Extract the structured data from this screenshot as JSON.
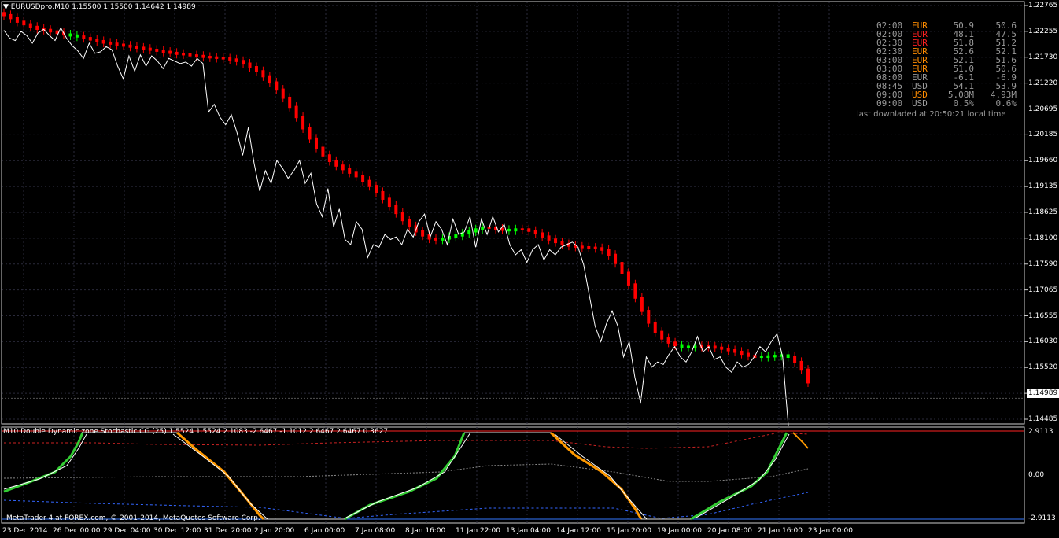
{
  "chart_header": "EURUSDpro,M10  1.15500 1.15500 1.14642 1.14989",
  "indicator_header": "M10 Double Dynamic zone Stochastic CG (25) 1.5524 1.5524 2.1083 -2.6467 -1.1012 2.6467 2.6467 0.3627",
  "footer_text": "MetaTrader 4 at FOREX.com, © 2001-2014, MetaQuotes Software Corp.",
  "colors": {
    "background": "#000000",
    "bear": "#ff0000",
    "bull": "#00ff00",
    "line": "#ffffff",
    "grid": "#2a2a3a",
    "stoch_up": "#33cc33",
    "stoch_down": "#ff9900",
    "zone_upper": "#ff2222",
    "zone_lower": "#3377ff",
    "mid_zone": "#888888",
    "news_orange": "#ff8c00",
    "news_red": "#ff2020",
    "news_gray": "#9a9a9a"
  },
  "news_table": {
    "rows": [
      {
        "time": "02:00",
        "cur": "EUR",
        "a": "50.9",
        "b": "50.6",
        "cur_color": "orange"
      },
      {
        "time": "02:00",
        "cur": "EUR",
        "a": "48.1",
        "b": "47.5",
        "cur_color": "red"
      },
      {
        "time": "02:30",
        "cur": "EUR",
        "a": "51.8",
        "b": "51.2",
        "cur_color": "red"
      },
      {
        "time": "02:30",
        "cur": "EUR",
        "a": "52.6",
        "b": "52.1",
        "cur_color": "orange"
      },
      {
        "time": "03:00",
        "cur": "EUR",
        "a": "52.1",
        "b": "51.6",
        "cur_color": "orange"
      },
      {
        "time": "03:00",
        "cur": "EUR",
        "a": "51.0",
        "b": "50.6",
        "cur_color": "orange"
      },
      {
        "time": "08:00",
        "cur": "EUR",
        "a": "-6.1",
        "b": "-6.9",
        "cur_color": "gray"
      },
      {
        "time": "08:45",
        "cur": "USD",
        "a": "54.1",
        "b": "53.9",
        "cur_color": "gray"
      },
      {
        "time": "09:00",
        "cur": "USD",
        "a": "5.08M",
        "b": "4.93M",
        "cur_color": "orange"
      },
      {
        "time": "09:00",
        "cur": "USD",
        "a": "0.5%",
        "b": "0.6%",
        "cur_color": "gray"
      }
    ],
    "last_downloaded": "last downladed at 20:50:21 local time"
  },
  "price_axis_labels": [
    "1.22765",
    "1.22255",
    "1.21730",
    "1.21220",
    "1.20695",
    "1.20185",
    "1.19660",
    "1.19135",
    "1.18625",
    "1.18100",
    "1.17590",
    "1.17065",
    "1.16555",
    "1.16030",
    "1.15520",
    "1.14989",
    "1.14485"
  ],
  "current_price": "1.14989",
  "indicator_axis_labels": [
    "2.9113",
    "0.00",
    "-2.9113"
  ],
  "time_axis_labels": [
    "23 Dec 2014",
    "26 Dec 00:00",
    "29 Dec 04:00",
    "30 Dec 12:00",
    "31 Dec 20:00",
    "2 Jan 20:00",
    "6 Jan 00:00",
    "7 Jan 08:00",
    "8 Jan 16:00",
    "11 Jan 22:00",
    "13 Jan 04:00",
    "14 Jan 12:00",
    "15 Jan 20:00",
    "19 Jan 00:00",
    "20 Jan 08:00",
    "21 Jan 16:00",
    "23 Jan 00:00"
  ],
  "chart_data": {
    "type": "candlestick",
    "symbol": "EURUSDpro",
    "timeframe": "M10",
    "ylim": [
      1.14485,
      1.22765
    ],
    "heikin_ashi_mid": [
      1.225,
      1.2244,
      1.2237,
      1.2232,
      1.2227,
      1.2223,
      1.2221,
      1.2218,
      1.2215,
      1.2212,
      1.221,
      1.2208,
      1.2205,
      1.2202,
      1.2199,
      1.2196,
      1.2194,
      1.2192,
      1.219,
      1.2188,
      1.2186,
      1.2184,
      1.2182,
      1.218,
      1.2178,
      1.2176,
      1.2174,
      1.2173,
      1.2171,
      1.217,
      1.2168,
      1.2167,
      1.2166,
      1.2165,
      1.2163,
      1.216,
      1.2155,
      1.2148,
      1.214,
      1.213,
      1.2118,
      1.2104,
      1.2088,
      1.207,
      1.205,
      1.2028,
      1.2008,
      1.199,
      1.1975,
      1.1964,
      1.1955,
      1.1948,
      1.1941,
      1.1934,
      1.1925,
      1.1915,
      1.1903,
      1.189,
      1.1876,
      1.1862,
      1.1848,
      1.1836,
      1.1826,
      1.1818,
      1.1812,
      1.181,
      1.1812,
      1.1815,
      1.1818,
      1.1822,
      1.1826,
      1.183,
      1.1833,
      1.1833,
      1.1831,
      1.1829,
      1.1828,
      1.183,
      1.183,
      1.1827,
      1.1822,
      1.1816,
      1.181,
      1.1805,
      1.1801,
      1.1798,
      1.1796,
      1.1795,
      1.1794,
      1.1793,
      1.179,
      1.178,
      1.1764,
      1.1745,
      1.1722,
      1.1696,
      1.167,
      1.1647,
      1.1629,
      1.1616,
      1.1608,
      1.1603,
      1.16,
      1.16,
      1.16,
      1.1601,
      1.16,
      1.1598,
      1.1596,
      1.1593,
      1.159,
      1.1586,
      1.1582,
      1.158,
      1.158,
      1.1581,
      1.1582,
      1.1583,
      1.158,
      1.157,
      1.1555,
      1.153
    ],
    "heikin_ashi_bull": [
      0,
      0,
      0,
      0,
      0,
      0,
      0,
      0,
      0,
      0,
      1,
      1,
      0,
      0,
      0,
      0,
      0,
      0,
      0,
      0,
      0,
      0,
      0,
      0,
      0,
      0,
      0,
      0,
      0,
      0,
      0,
      0,
      0,
      0,
      0,
      0,
      0,
      0,
      0,
      0,
      0,
      0,
      0,
      0,
      0,
      0,
      0,
      0,
      0,
      0,
      0,
      0,
      0,
      0,
      0,
      0,
      0,
      0,
      0,
      0,
      0,
      0,
      0,
      0,
      0,
      0,
      1,
      1,
      1,
      1,
      1,
      1,
      1,
      0,
      0,
      0,
      1,
      1,
      0,
      0,
      0,
      0,
      0,
      0,
      0,
      0,
      0,
      0,
      0,
      0,
      0,
      0,
      0,
      0,
      0,
      0,
      0,
      0,
      0,
      0,
      0,
      0,
      1,
      1,
      1,
      0,
      0,
      0,
      0,
      0,
      0,
      0,
      0,
      0,
      1,
      1,
      1,
      1,
      1,
      0,
      0,
      0
    ],
    "line_close": [
      1.222,
      1.2205,
      1.22,
      1.2218,
      1.221,
      1.2195,
      1.2215,
      1.2222,
      1.221,
      1.22,
      1.2225,
      1.2205,
      1.219,
      1.218,
      1.2165,
      1.2195,
      1.2175,
      1.2178,
      1.2188,
      1.2182,
      1.215,
      1.2125,
      1.217,
      1.214,
      1.2172,
      1.215,
      1.217,
      1.216,
      1.2145,
      1.2165,
      1.216,
      1.2155,
      1.2158,
      1.215,
      1.2165,
      1.2155,
      1.206,
      1.2075,
      1.205,
      1.2035,
      1.2055,
      1.202,
      1.1975,
      1.203,
      1.196,
      1.1905,
      1.1945,
      1.192,
      1.1965,
      1.195,
      1.193,
      1.1945,
      1.1965,
      1.192,
      1.194,
      1.188,
      1.1855,
      1.191,
      1.1835,
      1.187,
      1.181,
      1.18,
      1.1845,
      1.183,
      1.1775,
      1.18,
      1.1795,
      1.182,
      1.181,
      1.1815,
      1.18,
      1.183,
      1.1815,
      1.1845,
      1.186,
      1.1815,
      1.1845,
      1.183,
      1.18,
      1.185,
      1.182,
      1.1825,
      1.1855,
      1.1795,
      1.185,
      1.182,
      1.1855,
      1.1825,
      1.184,
      1.18,
      1.178,
      1.179,
      1.1765,
      1.179,
      1.18,
      1.177,
      1.179,
      1.178,
      1.1795,
      1.18,
      1.1805,
      1.1795,
      1.176,
      1.17,
      1.164,
      1.161,
      1.1645,
      1.167,
      1.164,
      1.158,
      1.161,
      1.154,
      1.149,
      1.158,
      1.156,
      1.157,
      1.1565,
      1.1585,
      1.16,
      1.158,
      1.157,
      1.159,
      1.162,
      1.159,
      1.16,
      1.1575,
      1.158,
      1.156,
      1.155,
      1.157,
      1.156,
      1.1565,
      1.158,
      1.16,
      1.159,
      1.161,
      1.1625,
      1.158,
      1.1445
    ]
  },
  "indicator_data": {
    "ylim": [
      -2.9113,
      2.9113
    ],
    "upper_level": 2.9113,
    "lower_level": -2.9113,
    "zero_level": 0.0
  }
}
